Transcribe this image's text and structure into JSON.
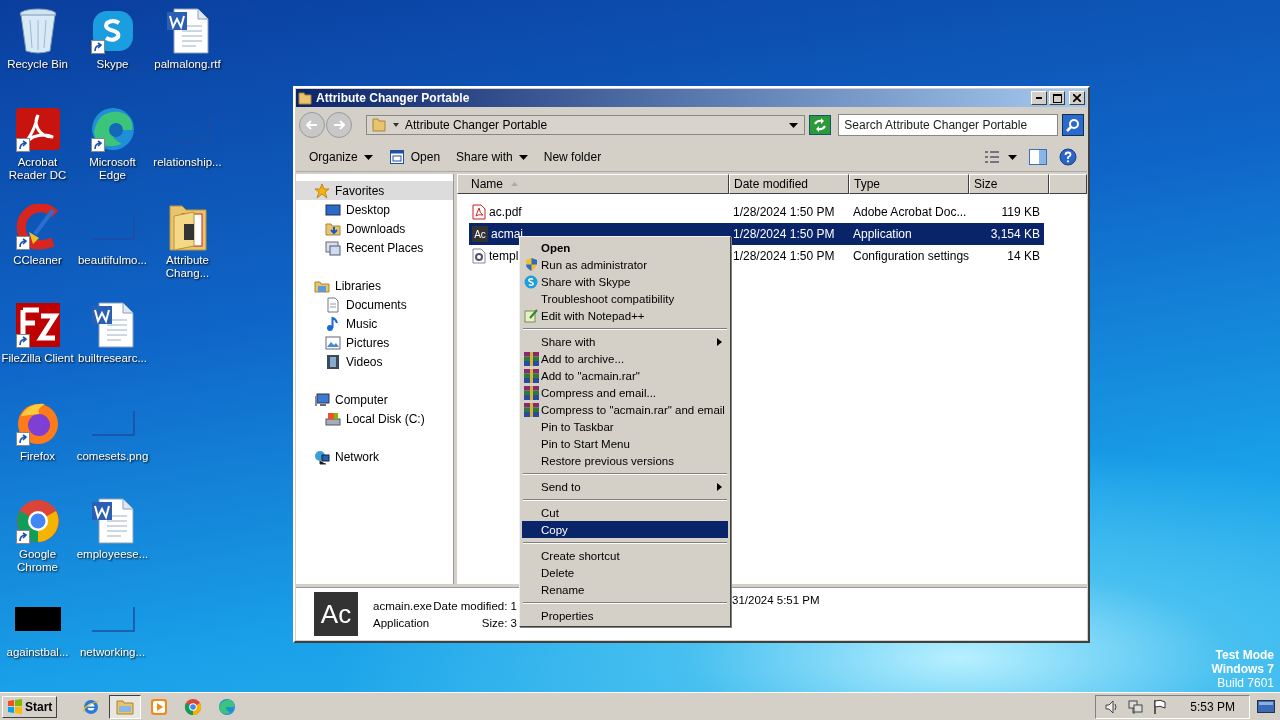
{
  "desktop": {
    "columns": [
      {
        "icons": [
          {
            "label": "Recycle Bin",
            "kind": "recycle",
            "shortcut": false
          },
          {
            "label": "Acrobat Reader DC",
            "kind": "acrobat",
            "shortcut": true
          },
          {
            "label": "CCleaner",
            "kind": "ccleaner",
            "shortcut": true
          },
          {
            "label": "FileZilla Client",
            "kind": "filezilla",
            "shortcut": true
          },
          {
            "label": "Firefox",
            "kind": "firefox",
            "shortcut": true
          },
          {
            "label": "Google Chrome",
            "kind": "chrome",
            "shortcut": true
          },
          {
            "label": "againstbal...",
            "kind": "black",
            "shortcut": false
          }
        ]
      },
      {
        "icons": [
          {
            "label": "Skype",
            "kind": "skype",
            "shortcut": true
          },
          {
            "label": "Microsoft Edge",
            "kind": "edge",
            "shortcut": true
          },
          {
            "label": "beautifulmo...",
            "kind": "blank",
            "shortcut": false
          },
          {
            "label": "builtresearc...",
            "kind": "word",
            "shortcut": false
          },
          {
            "label": "comesets.png",
            "kind": "blank",
            "shortcut": false
          },
          {
            "label": "employeese...",
            "kind": "word",
            "shortcut": false
          },
          {
            "label": "networking...",
            "kind": "blank",
            "shortcut": false
          }
        ]
      },
      {
        "icons": [
          {
            "label": "palmalong.rtf",
            "kind": "word",
            "shortcut": false
          },
          {
            "label": "relationship...",
            "kind": "blank",
            "shortcut": false
          },
          {
            "label": "Attribute Chang...",
            "kind": "folder",
            "shortcut": false
          }
        ]
      }
    ],
    "notice": [
      "Test Mode",
      "Windows 7",
      "Build 7601"
    ]
  },
  "window": {
    "title": "Attribute Changer Portable",
    "address": "Attribute Changer Portable",
    "search_placeholder": "Search Attribute Changer Portable",
    "toolbar": [
      {
        "label": "Organize",
        "kind": "dropdown"
      },
      {
        "label": "Open",
        "kind": "open"
      },
      {
        "label": "Share with",
        "kind": "dropdown"
      },
      {
        "label": "New folder",
        "kind": "plain"
      }
    ],
    "nav_pane": {
      "items": [
        {
          "label": "Favorites",
          "kind": "star",
          "selected": true,
          "children": [
            {
              "label": "Desktop",
              "kind": "desktop",
              "selected": false
            },
            {
              "label": "Downloads",
              "kind": "downloads",
              "selected": false
            },
            {
              "label": "Recent Places",
              "kind": "recent",
              "selected": false
            }
          ]
        },
        {
          "label": "Libraries",
          "kind": "libraries",
          "selected": false,
          "children": [
            {
              "label": "Documents",
              "kind": "documents",
              "selected": false
            },
            {
              "label": "Music",
              "kind": "music",
              "selected": false
            },
            {
              "label": "Pictures",
              "kind": "pictures",
              "selected": false
            },
            {
              "label": "Videos",
              "kind": "videos",
              "selected": false
            }
          ]
        },
        {
          "label": "Computer",
          "kind": "computer",
          "selected": false,
          "children": [
            {
              "label": "Local Disk (C:)",
              "kind": "disk",
              "selected": false
            }
          ]
        },
        {
          "label": "Network",
          "kind": "network",
          "selected": false
        }
      ]
    },
    "file_list": {
      "columns": [
        {
          "label": "Name",
          "sorted": true
        },
        {
          "label": "Date modified",
          "sorted": false
        },
        {
          "label": "Type",
          "sorted": false
        },
        {
          "label": "Size",
          "sorted": false
        }
      ],
      "rows": [
        {
          "name": "ac.pdf",
          "kind": "pdf",
          "date": "1/28/2024 1:50 PM",
          "type": "Adobe Acrobat Doc...",
          "size": "119 KB",
          "selected": false
        },
        {
          "name": "acmai",
          "kind": "app",
          "icon_text": "Ac",
          "date": "1/28/2024 1:50 PM",
          "type": "Application",
          "size": "3,154 KB",
          "selected": true
        },
        {
          "name": "templ",
          "kind": "config",
          "date": "1/28/2024 1:50 PM",
          "type": "Configuration settings",
          "size": "14 KB",
          "selected": false
        }
      ]
    },
    "details": {
      "icon_text": "Ac",
      "name": "acmain.exe",
      "type": "Application",
      "date_label": "Date modified: 1",
      "size_label": "Size: 3",
      "date_tail": "31/2024 5:51 PM"
    }
  },
  "context_menu": {
    "items": [
      {
        "kind": "plain",
        "label": "Open",
        "default": true,
        "submenu": false,
        "selected": false
      },
      {
        "kind": "shield",
        "label": "Run as administrator",
        "default": false,
        "submenu": false,
        "selected": false
      },
      {
        "kind": "skype",
        "label": "Share with Skype",
        "default": false,
        "submenu": false,
        "selected": false
      },
      {
        "kind": "plain",
        "label": "Troubleshoot compatibility",
        "default": false,
        "submenu": false,
        "selected": false
      },
      {
        "kind": "notepad",
        "label": "Edit with Notepad++",
        "default": false,
        "submenu": false,
        "selected": false
      },
      {
        "kind": "separator"
      },
      {
        "kind": "plain",
        "label": "Share with",
        "default": false,
        "submenu": true,
        "selected": false
      },
      {
        "kind": "archive",
        "label": "Add to archive...",
        "default": false,
        "submenu": false,
        "selected": false
      },
      {
        "kind": "archive",
        "label": "Add to \"acmain.rar\"",
        "default": false,
        "submenu": false,
        "selected": false
      },
      {
        "kind": "archive",
        "label": "Compress and email...",
        "default": false,
        "submenu": false,
        "selected": false
      },
      {
        "kind": "archive",
        "label": "Compress to \"acmain.rar\" and email",
        "default": false,
        "submenu": false,
        "selected": false
      },
      {
        "kind": "plain",
        "label": "Pin to Taskbar",
        "default": false,
        "submenu": false,
        "selected": false
      },
      {
        "kind": "plain",
        "label": "Pin to Start Menu",
        "default": false,
        "submenu": false,
        "selected": false
      },
      {
        "kind": "plain",
        "label": "Restore previous versions",
        "default": false,
        "submenu": false,
        "selected": false
      },
      {
        "kind": "separator"
      },
      {
        "kind": "plain",
        "label": "Send to",
        "default": false,
        "submenu": true,
        "selected": false
      },
      {
        "kind": "separator"
      },
      {
        "kind": "plain",
        "label": "Cut",
        "default": false,
        "submenu": false,
        "selected": false
      },
      {
        "kind": "plain",
        "label": "Copy",
        "default": false,
        "submenu": false,
        "selected": true
      },
      {
        "kind": "separator"
      },
      {
        "kind": "plain",
        "label": "Create shortcut",
        "default": false,
        "submenu": false,
        "selected": false
      },
      {
        "kind": "plain",
        "label": "Delete",
        "default": false,
        "submenu": false,
        "selected": false
      },
      {
        "kind": "plain",
        "label": "Rename",
        "default": false,
        "submenu": false,
        "selected": false
      },
      {
        "kind": "separator"
      },
      {
        "kind": "plain",
        "label": "Properties",
        "default": false,
        "submenu": false,
        "selected": false
      }
    ]
  },
  "taskbar": {
    "start": "Start",
    "apps": [
      {
        "kind": "ie",
        "selected": false
      },
      {
        "kind": "explorer",
        "selected": true
      },
      {
        "kind": "media",
        "selected": false
      },
      {
        "kind": "chrome",
        "selected": false
      },
      {
        "kind": "edge",
        "selected": false
      }
    ],
    "clock": "5:53 PM"
  }
}
